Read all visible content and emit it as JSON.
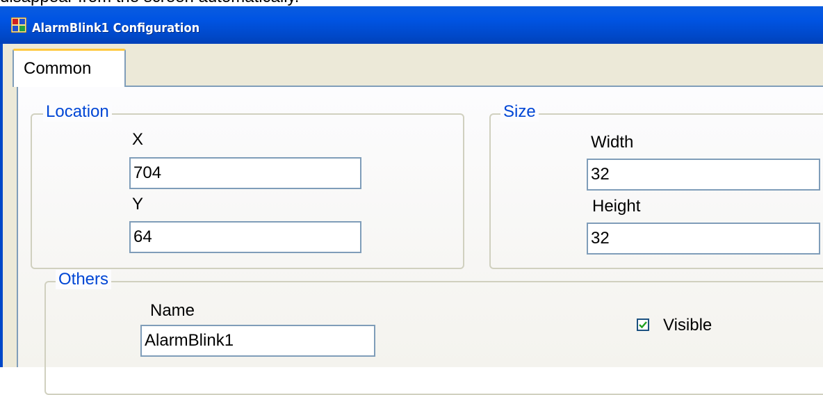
{
  "doc_text": "disappear from the screen automatically.",
  "window": {
    "title": "AlarmBlink1 Configuration",
    "icon": "app-window-icon"
  },
  "tabs": [
    {
      "label": "Common",
      "active": true
    }
  ],
  "location": {
    "title": "Location",
    "x_label": "X",
    "x_value": "704",
    "y_label": "Y",
    "y_value": "64"
  },
  "size": {
    "title": "Size",
    "width_label": "Width",
    "width_value": "32",
    "height_label": "Height",
    "height_value": "32"
  },
  "others": {
    "title": "Others",
    "name_label": "Name",
    "name_value": "AlarmBlink1",
    "visible_label": "Visible",
    "visible_checked": true
  },
  "colors": {
    "title_bar": "#0054e3",
    "group_title": "#0046d5",
    "field_border": "#7f9db9",
    "window_bg": "#ece9d8"
  }
}
